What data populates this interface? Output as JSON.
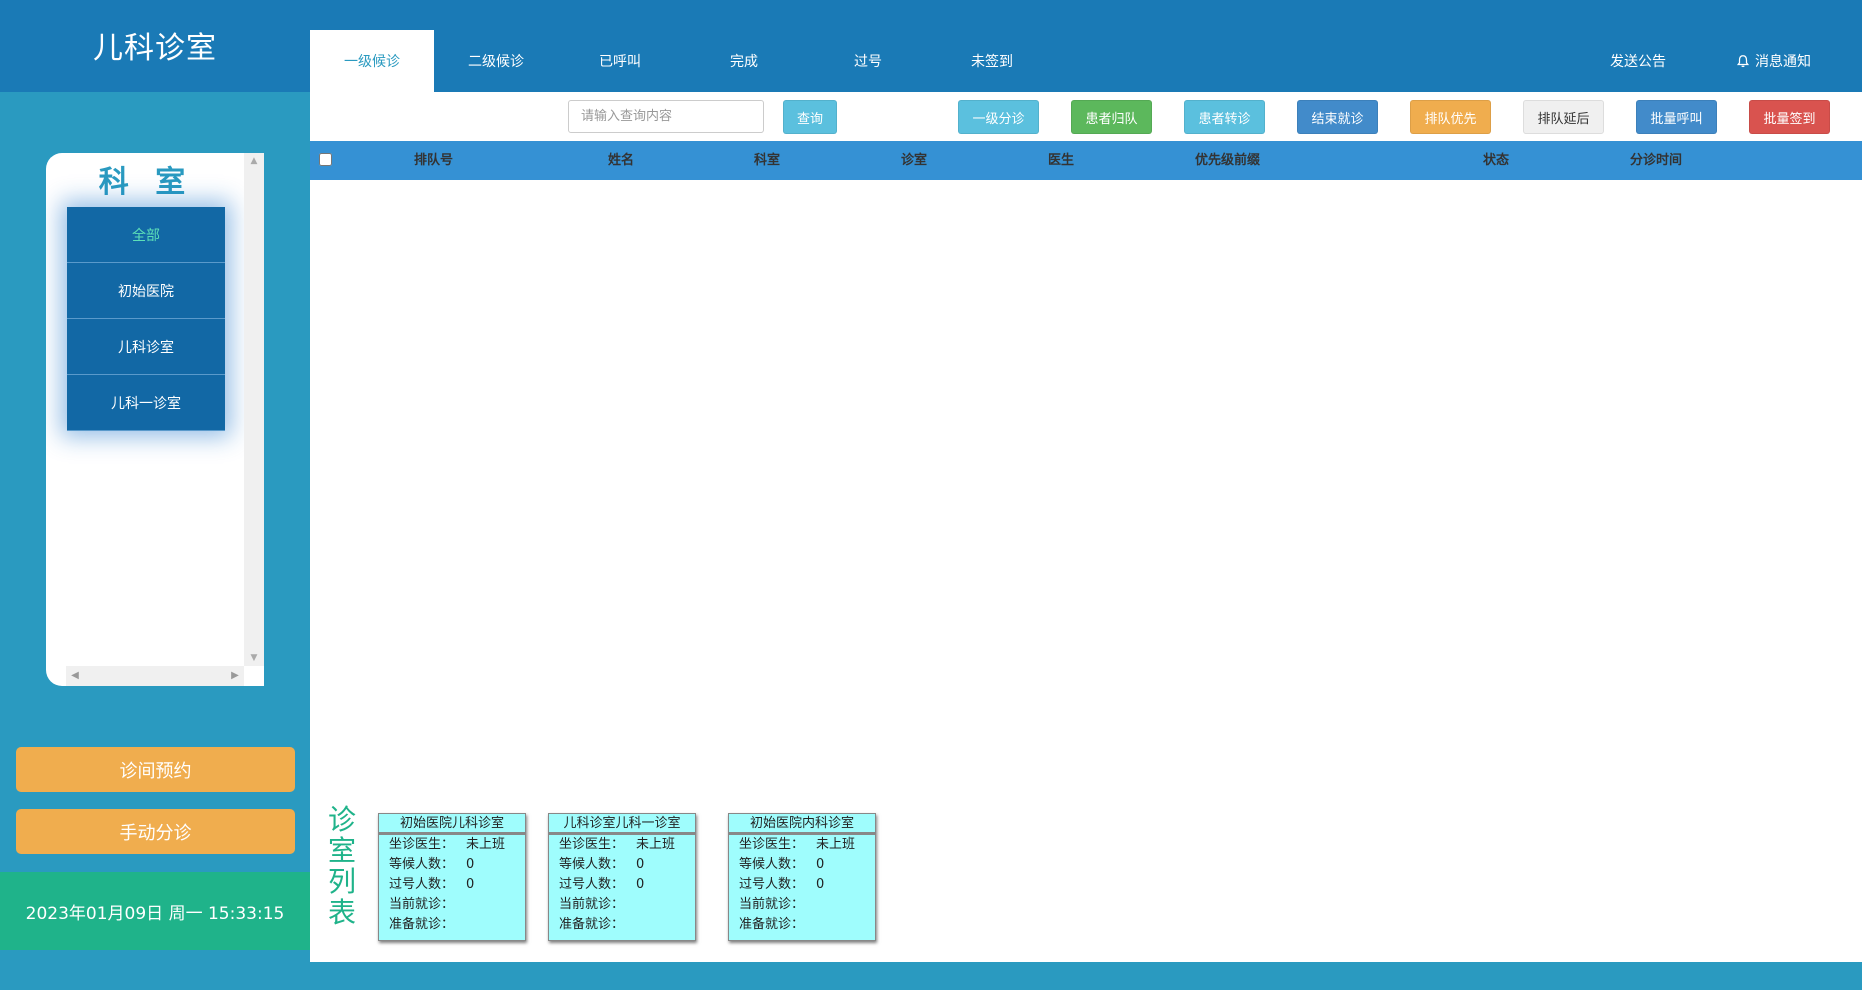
{
  "app": {
    "title": "儿科诊室"
  },
  "nav": {
    "tabs": [
      {
        "label": "一级候诊",
        "active": true
      },
      {
        "label": "二级候诊",
        "active": false
      },
      {
        "label": "已呼叫",
        "active": false
      },
      {
        "label": "完成",
        "active": false
      },
      {
        "label": "过号",
        "active": false
      },
      {
        "label": "未签到",
        "active": false
      }
    ],
    "send_notice": "发送公告",
    "messages": "消息通知"
  },
  "sidebar": {
    "title": "科 室",
    "items": [
      {
        "label": "全部",
        "active": true
      },
      {
        "label": "初始医院"
      },
      {
        "label": "儿科诊室"
      },
      {
        "label": "儿科一诊室"
      }
    ],
    "appointment_button": "诊间预约",
    "manual_button": "手动分诊",
    "datetime": "2023年01月09日 周一 15:33:15"
  },
  "toolbar": {
    "search_placeholder": "请输入查询内容",
    "query": "查询",
    "buttons": [
      {
        "label": "一级分诊",
        "color": "#5bc0de"
      },
      {
        "label": "患者归队",
        "color": "#5cb85c"
      },
      {
        "label": "患者转诊",
        "color": "#5bc0de"
      },
      {
        "label": "结束就诊",
        "color": "#428bca"
      },
      {
        "label": "排队优先",
        "color": "#f0ad4e"
      },
      {
        "label": "排队延后",
        "color": "#f0f0f0"
      },
      {
        "label": "批量呼叫",
        "color": "#428bca"
      },
      {
        "label": "批量签到",
        "color": "#d9534f"
      }
    ]
  },
  "table": {
    "columns": [
      "排队号",
      "姓名",
      "科室",
      "诊室",
      "医生",
      "优先级前缀",
      "状态",
      "分诊时间"
    ],
    "rows": []
  },
  "rooms": {
    "label": "诊室列表",
    "field_labels": {
      "doctor": "坐诊医生：",
      "waiting": "等候人数：",
      "missed": "过号人数：",
      "current": "当前就诊：",
      "next": "准备就诊："
    },
    "cards": [
      {
        "name": "初始医院儿科诊室",
        "doctor": "未上班",
        "waiting": "0",
        "missed": "0",
        "current": "",
        "next": ""
      },
      {
        "name": "儿科诊室儿科一诊室",
        "doctor": "未上班",
        "waiting": "0",
        "missed": "0",
        "current": "",
        "next": ""
      },
      {
        "name": "初始医院内科诊室",
        "doctor": "未上班",
        "waiting": "0",
        "missed": "0",
        "current": "",
        "next": ""
      }
    ]
  },
  "colors": {
    "nav_bg": "#1a7ab6",
    "sidebar_bg": "#2a9ac0",
    "accent_green": "#1fb38a",
    "orange": "#f0ad4e",
    "card_bg": "#9ffdfd"
  }
}
